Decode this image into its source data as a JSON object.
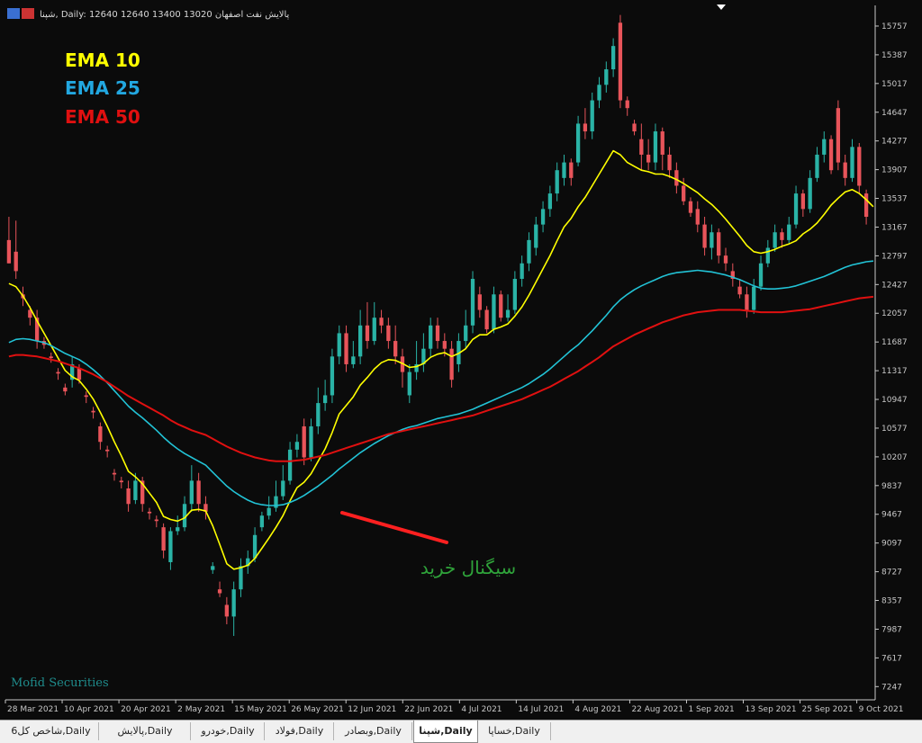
{
  "window": {
    "header_text": "شپنا, Daily:  12640 12640 13400 13020  پالایش نفت اصفهان"
  },
  "legend": {
    "ema10_label": "EMA 10",
    "ema25_label": "EMA 25",
    "ema50_label": "EMA 50"
  },
  "annotation": {
    "signal_text": "سیگنال خرید",
    "signal_color": "#2fa33a",
    "arrow_color": "#ff2020"
  },
  "watermark": "Mofid Securities",
  "colors": {
    "background": "#0b0b0b",
    "up_candle": "#2ab3a6",
    "down_candle": "#e8545a",
    "ema10": "#ffff00",
    "ema25": "#22c3d6",
    "ema50": "#e01010",
    "grid": "#2a2a2a",
    "axis_text": "#c8c8c8"
  },
  "chart_data": {
    "type": "candlestick",
    "title": "شپنا, Daily",
    "ylim": [
      7100,
      16000
    ],
    "y_ticks": [
      15757,
      15387,
      15017,
      14647,
      14277,
      13907,
      13537,
      13167,
      12797,
      12427,
      12057,
      11687,
      11317,
      10947,
      10577,
      10207,
      9837,
      9467,
      9097,
      8727,
      8357,
      7987,
      7617,
      7247
    ],
    "x_ticks": [
      "28 Mar 2021",
      "10 Apr 2021",
      "20 Apr 2021",
      "2 May 2021",
      "15 May 2021",
      "26 May 2021",
      "12 Jun 2021",
      "22 Jun 2021",
      "4 Jul 2021",
      "14 Jul 2021",
      "4 Aug 2021",
      "22 Aug 2021",
      "1 Sep 2021",
      "13 Sep 2021",
      "25 Sep 2021",
      "9 Oct 2021"
    ],
    "candles": [
      [
        13000,
        12700,
        13300,
        12700
      ],
      [
        12850,
        12600,
        13250,
        12500
      ],
      [
        12300,
        12250,
        12400,
        12150
      ],
      [
        12100,
        12000,
        12150,
        11900
      ],
      [
        12000,
        11700,
        12100,
        11600
      ],
      [
        11700,
        11650,
        11750,
        11600
      ],
      [
        11500,
        11480,
        11550,
        11420
      ],
      [
        11300,
        11280,
        11350,
        11200
      ],
      [
        11100,
        11050,
        11150,
        11000
      ],
      [
        11200,
        11400,
        11500,
        11100
      ],
      [
        11350,
        11200,
        11400,
        11150
      ],
      [
        11000,
        10980,
        11050,
        10900
      ],
      [
        10800,
        10780,
        10850,
        10700
      ],
      [
        10600,
        10400,
        10650,
        10300
      ],
      [
        10300,
        10280,
        10350,
        10200
      ],
      [
        10000,
        9980,
        10050,
        9900
      ],
      [
        9900,
        9880,
        9950,
        9800
      ],
      [
        9800,
        9600,
        9900,
        9500
      ],
      [
        9650,
        9900,
        10000,
        9600
      ],
      [
        9900,
        9600,
        9950,
        9500
      ],
      [
        9500,
        9480,
        9550,
        9400
      ],
      [
        9400,
        9380,
        9450,
        9300
      ],
      [
        9300,
        9000,
        9350,
        8900
      ],
      [
        8850,
        9250,
        9300,
        8750
      ],
      [
        9250,
        9300,
        9450,
        9200
      ],
      [
        9300,
        9600,
        9700,
        9250
      ],
      [
        9600,
        9900,
        10100,
        9500
      ],
      [
        9900,
        9600,
        10000,
        9500
      ],
      [
        9600,
        9500,
        9700,
        9400
      ],
      [
        8750,
        8800,
        8850,
        8700
      ],
      [
        8500,
        8450,
        8600,
        8400
      ],
      [
        8300,
        8150,
        8400,
        8050
      ],
      [
        8150,
        8500,
        8600,
        7900
      ],
      [
        8500,
        8800,
        8900,
        8400
      ],
      [
        8800,
        8900,
        9000,
        8700
      ],
      [
        8900,
        9200,
        9300,
        8850
      ],
      [
        9300,
        9450,
        9500,
        9250
      ],
      [
        9450,
        9550,
        9700,
        9400
      ],
      [
        9550,
        9700,
        9900,
        9500
      ],
      [
        9700,
        9900,
        10100,
        9650
      ],
      [
        9900,
        10300,
        10400,
        9850
      ],
      [
        10300,
        10400,
        10500,
        10200
      ],
      [
        10600,
        10200,
        10700,
        10100
      ],
      [
        10200,
        10600,
        10700,
        10150
      ],
      [
        10600,
        10900,
        11100,
        10500
      ],
      [
        10900,
        11000,
        11200,
        10800
      ],
      [
        11000,
        11500,
        11600,
        10900
      ],
      [
        11500,
        11800,
        11900,
        11400
      ],
      [
        11800,
        11400,
        11900,
        11300
      ],
      [
        11400,
        11500,
        11700,
        11350
      ],
      [
        11500,
        11900,
        12100,
        11400
      ],
      [
        11900,
        11700,
        12200,
        11600
      ],
      [
        11700,
        12000,
        12200,
        11650
      ],
      [
        12000,
        11900,
        12100,
        11800
      ],
      [
        11900,
        11700,
        12000,
        11600
      ],
      [
        11700,
        11500,
        11900,
        11400
      ],
      [
        11500,
        11300,
        11600,
        11100
      ],
      [
        11000,
        11300,
        11400,
        10900
      ],
      [
        11300,
        11400,
        11700,
        11200
      ],
      [
        11400,
        11600,
        11800,
        11300
      ],
      [
        11600,
        11900,
        12000,
        11500
      ],
      [
        11900,
        11700,
        12000,
        11600
      ],
      [
        11700,
        11600,
        11800,
        11500
      ],
      [
        11600,
        11200,
        11700,
        11100
      ],
      [
        11400,
        11700,
        11800,
        11300
      ],
      [
        11700,
        11900,
        12100,
        11600
      ],
      [
        11900,
        12500,
        12600,
        11800
      ],
      [
        12300,
        12100,
        12400,
        12000
      ],
      [
        12100,
        11850,
        12150,
        11800
      ],
      [
        11850,
        12300,
        12400,
        11800
      ],
      [
        12300,
        12000,
        12350,
        11950
      ],
      [
        12000,
        12100,
        12300,
        11950
      ],
      [
        12100,
        12500,
        12600,
        12050
      ],
      [
        12500,
        12700,
        12800,
        12400
      ],
      [
        12700,
        13000,
        13100,
        12600
      ],
      [
        12900,
        13200,
        13300,
        12800
      ],
      [
        13200,
        13400,
        13500,
        13100
      ],
      [
        13400,
        13600,
        13700,
        13300
      ],
      [
        13600,
        13900,
        14000,
        13500
      ],
      [
        13800,
        14000,
        14100,
        13700
      ],
      [
        14000,
        13800,
        14050,
        13700
      ],
      [
        14000,
        14500,
        14600,
        13950
      ],
      [
        14500,
        14400,
        14700,
        14300
      ],
      [
        14400,
        14800,
        14900,
        14300
      ],
      [
        14800,
        15000,
        15100,
        14700
      ],
      [
        15000,
        15200,
        15300,
        14900
      ],
      [
        15200,
        15500,
        15600,
        15100
      ],
      [
        15800,
        14800,
        15900,
        14700
      ],
      [
        14800,
        14700,
        14850,
        14600
      ],
      [
        14500,
        14400,
        14550,
        14350
      ],
      [
        14300,
        14100,
        14500,
        13900
      ],
      [
        14100,
        14000,
        14300,
        13900
      ],
      [
        14000,
        14400,
        14500,
        13900
      ],
      [
        14400,
        14100,
        14450,
        13900
      ],
      [
        14100,
        13900,
        14200,
        13800
      ],
      [
        13900,
        13700,
        14000,
        13600
      ],
      [
        13700,
        13500,
        13800,
        13450
      ],
      [
        13500,
        13350,
        13550,
        13300
      ],
      [
        13400,
        13200,
        13500,
        13100
      ],
      [
        13200,
        12900,
        13300,
        12800
      ],
      [
        12900,
        13100,
        13200,
        12750
      ],
      [
        13100,
        12800,
        13150,
        12700
      ],
      [
        12800,
        12700,
        12900,
        12600
      ],
      [
        12600,
        12500,
        12700,
        12400
      ],
      [
        12400,
        12300,
        12500,
        12250
      ],
      [
        12300,
        12100,
        12400,
        12000
      ],
      [
        12100,
        12400,
        12500,
        12050
      ],
      [
        12400,
        12700,
        12800,
        12350
      ],
      [
        12700,
        12900,
        13000,
        12650
      ],
      [
        12900,
        13100,
        13200,
        12850
      ],
      [
        13100,
        13000,
        13150,
        12900
      ],
      [
        13000,
        13200,
        13300,
        12950
      ],
      [
        13200,
        13600,
        13700,
        13150
      ],
      [
        13600,
        13400,
        13650,
        13300
      ],
      [
        13400,
        13800,
        13900,
        13350
      ],
      [
        13800,
        14100,
        14200,
        13750
      ],
      [
        14100,
        14300,
        14400,
        14000
      ],
      [
        14300,
        13900,
        14350,
        13850
      ],
      [
        14700,
        14000,
        14800,
        13900
      ],
      [
        14000,
        13800,
        14100,
        13700
      ],
      [
        13800,
        14200,
        14300,
        13750
      ],
      [
        14200,
        13700,
        14250,
        13600
      ],
      [
        13600,
        13300,
        13650,
        13200
      ]
    ],
    "series": [
      {
        "name": "EMA 10",
        "values": [
          12440,
          12400,
          12280,
          12130,
          11960,
          11800,
          11640,
          11480,
          11320,
          11240,
          11190,
          11080,
          10950,
          10780,
          10600,
          10400,
          10220,
          10020,
          9950,
          9860,
          9740,
          9620,
          9440,
          9400,
          9380,
          9420,
          9520,
          9530,
          9510,
          9320,
          9080,
          8830,
          8760,
          8780,
          8810,
          8900,
          9030,
          9160,
          9300,
          9450,
          9640,
          9810,
          9880,
          9990,
          10150,
          10310,
          10520,
          10760,
          10870,
          10980,
          11130,
          11230,
          11340,
          11420,
          11460,
          11450,
          11410,
          11360,
          11370,
          11410,
          11490,
          11530,
          11550,
          11500,
          11540,
          11600,
          11720,
          11780,
          11780,
          11850,
          11880,
          11920,
          12020,
          12140,
          12290,
          12460,
          12630,
          12800,
          12990,
          13170,
          13280,
          13430,
          13550,
          13700,
          13850,
          14000,
          14150,
          14100,
          14000,
          13950,
          13900,
          13880,
          13850,
          13850,
          13820,
          13780,
          13730,
          13670,
          13610,
          13530,
          13460,
          13370,
          13270,
          13160,
          13050,
          12930,
          12850,
          12830,
          12850,
          12880,
          12920,
          12950,
          12990,
          13080,
          13140,
          13220,
          13330,
          13450,
          13540,
          13620,
          13650,
          13600,
          13520,
          13430
        ]
      },
      {
        "name": "EMA 25",
        "values": [
          11680,
          11720,
          11730,
          11720,
          11700,
          11680,
          11640,
          11590,
          11540,
          11500,
          11460,
          11400,
          11330,
          11250,
          11160,
          11060,
          10960,
          10860,
          10780,
          10710,
          10630,
          10550,
          10460,
          10380,
          10310,
          10250,
          10200,
          10150,
          10100,
          10010,
          9920,
          9830,
          9760,
          9700,
          9650,
          9610,
          9590,
          9580,
          9580,
          9590,
          9620,
          9660,
          9710,
          9770,
          9830,
          9900,
          9970,
          10050,
          10120,
          10190,
          10260,
          10320,
          10380,
          10430,
          10480,
          10520,
          10560,
          10590,
          10610,
          10640,
          10670,
          10700,
          10720,
          10740,
          10760,
          10790,
          10820,
          10860,
          10900,
          10940,
          10980,
          11020,
          11060,
          11100,
          11150,
          11210,
          11270,
          11340,
          11420,
          11500,
          11580,
          11650,
          11740,
          11830,
          11930,
          12030,
          12140,
          12230,
          12300,
          12360,
          12410,
          12450,
          12490,
          12530,
          12560,
          12580,
          12590,
          12600,
          12610,
          12600,
          12590,
          12570,
          12550,
          12520,
          12490,
          12450,
          12410,
          12380,
          12370,
          12370,
          12380,
          12390,
          12410,
          12440,
          12470,
          12500,
          12530,
          12570,
          12610,
          12650,
          12680,
          12700,
          12720,
          12730
        ]
      },
      {
        "name": "EMA 50",
        "values": [
          11500,
          11520,
          11520,
          11510,
          11500,
          11480,
          11460,
          11440,
          11410,
          11380,
          11350,
          11310,
          11270,
          11220,
          11170,
          11110,
          11050,
          10990,
          10940,
          10890,
          10840,
          10790,
          10740,
          10680,
          10630,
          10590,
          10550,
          10520,
          10490,
          10440,
          10390,
          10340,
          10300,
          10260,
          10230,
          10200,
          10180,
          10160,
          10150,
          10150,
          10150,
          10160,
          10170,
          10190,
          10210,
          10230,
          10260,
          10290,
          10320,
          10350,
          10380,
          10410,
          10440,
          10470,
          10500,
          10520,
          10540,
          10560,
          10580,
          10600,
          10620,
          10640,
          10660,
          10680,
          10700,
          10720,
          10740,
          10770,
          10800,
          10830,
          10860,
          10890,
          10920,
          10950,
          10990,
          11030,
          11070,
          11110,
          11160,
          11210,
          11260,
          11310,
          11370,
          11430,
          11490,
          11560,
          11630,
          11680,
          11730,
          11780,
          11820,
          11860,
          11900,
          11940,
          11970,
          12000,
          12030,
          12050,
          12070,
          12080,
          12090,
          12100,
          12100,
          12100,
          12100,
          12090,
          12080,
          12070,
          12070,
          12070,
          12070,
          12080,
          12090,
          12100,
          12110,
          12130,
          12150,
          12170,
          12190,
          12210,
          12230,
          12250,
          12260,
          12270
        ]
      }
    ]
  },
  "tabs": [
    {
      "label": "شاخص کل6,Daily",
      "active": false
    },
    {
      "label": "پالایش,Daily",
      "active": false
    },
    {
      "label": "خودرو,Daily",
      "active": false
    },
    {
      "label": "فولاد,Daily",
      "active": false
    },
    {
      "label": "وبصادر,Daily",
      "active": false
    },
    {
      "label": "شپنا,Daily",
      "active": true
    },
    {
      "label": "خساپا,Daily",
      "active": false
    }
  ]
}
